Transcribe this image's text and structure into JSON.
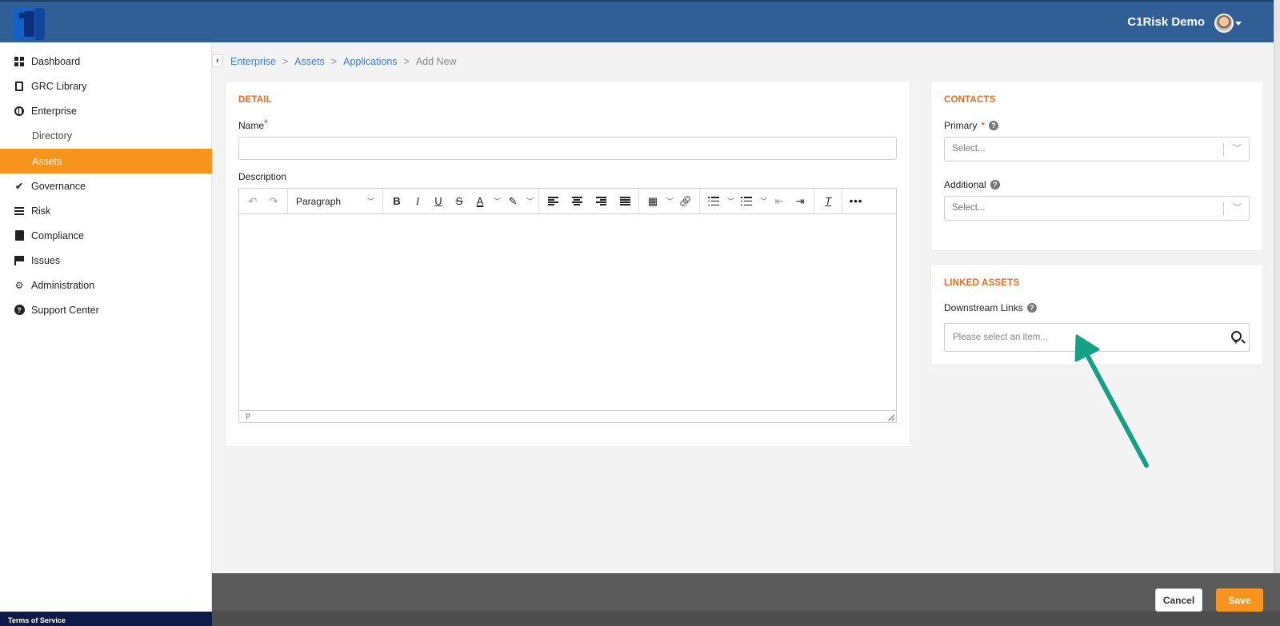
{
  "header": {
    "user_name": "C1Risk Demo"
  },
  "sidebar": {
    "items": [
      {
        "label": "Dashboard",
        "icon": "dashboard-icon"
      },
      {
        "label": "GRC Library",
        "icon": "book-icon"
      },
      {
        "label": "Enterprise",
        "icon": "globe-icon"
      },
      {
        "label": "Directory",
        "icon": ""
      },
      {
        "label": "Assets",
        "icon": "",
        "active": true
      },
      {
        "label": "Governance",
        "icon": "check-icon"
      },
      {
        "label": "Risk",
        "icon": "list-icon"
      },
      {
        "label": "Compliance",
        "icon": "clipboard-icon"
      },
      {
        "label": "Issues",
        "icon": "flag-icon"
      },
      {
        "label": "Administration",
        "icon": "gear-icon"
      },
      {
        "label": "Support Center",
        "icon": "question-icon"
      }
    ],
    "footer_link": "Terms of Service"
  },
  "breadcrumb": {
    "items": [
      "Enterprise",
      "Assets",
      "Applications",
      "Add New"
    ],
    "separator": ">"
  },
  "detail": {
    "title": "DETAIL",
    "name_label": "Name",
    "name_required": "*",
    "description_label": "Description",
    "editor": {
      "block_format": "Paragraph",
      "status_path": "P"
    }
  },
  "contacts": {
    "title": "CONTACTS",
    "primary_label": "Primary",
    "primary_required": "*",
    "primary_placeholder": "Select...",
    "additional_label": "Additional",
    "additional_placeholder": "Select..."
  },
  "linked_assets": {
    "title": "LINKED ASSETS",
    "downstream_label": "Downstream Links",
    "downstream_placeholder": "Please select an item..."
  },
  "footer": {
    "cancel_label": "Cancel",
    "save_label": "Save"
  },
  "colors": {
    "topbar": "#2f5f95",
    "accent": "#f7941d",
    "section_title": "#f26b1d",
    "link": "#3b7dd8",
    "annotation_arrow": "#13a085"
  }
}
